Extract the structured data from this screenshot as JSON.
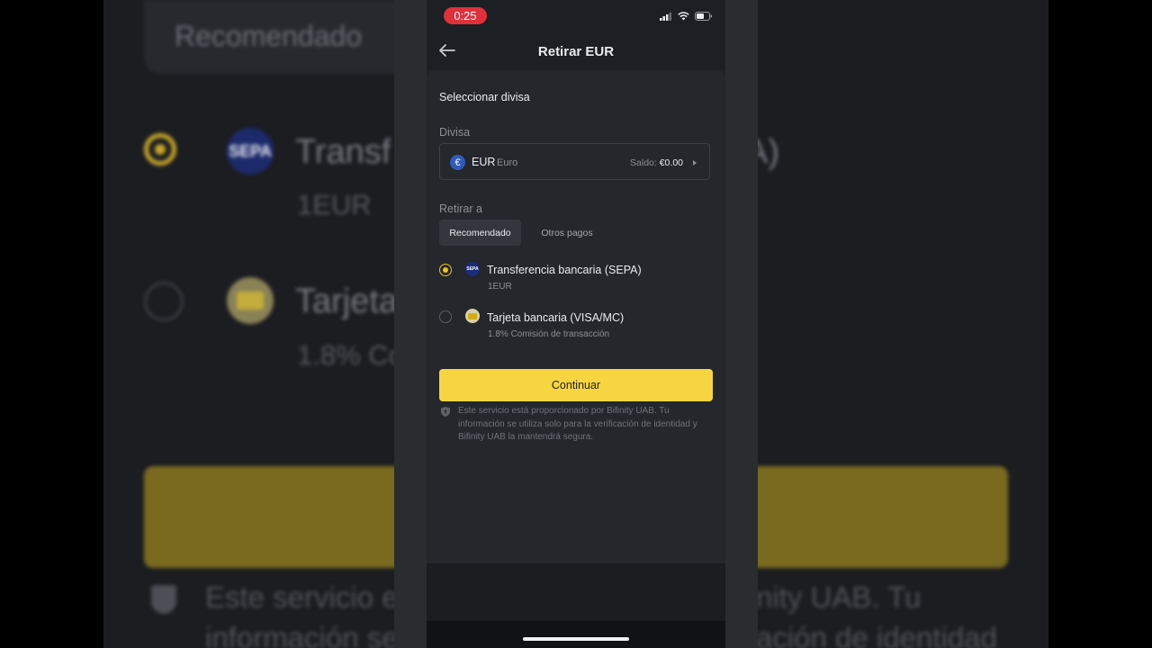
{
  "background": {
    "tab_recomendado": "Recomendado",
    "sepa_badge": "SEPA",
    "method1_title": "Transf",
    "method1_title_right": "A)",
    "method1_fee": "1EUR",
    "method2_title": "Tarjeta",
    "method2_fee": "1.8% Co",
    "disclaimer_left_1": "Este servicio e",
    "disclaimer_right_1": "nity UAB. Tu",
    "disclaimer_left_2": "información se",
    "disclaimer_right_2": "ación de identidad"
  },
  "status_bar": {
    "time": "0:25",
    "icons": [
      "signal-icon",
      "wifi-icon",
      "battery-icon"
    ]
  },
  "header": {
    "back_icon": "arrow-left-icon",
    "title": "Retirar EUR"
  },
  "currency_section": {
    "title": "Seleccionar divisa",
    "label": "Divisa",
    "currency_symbol": "€",
    "currency_code": "EUR",
    "currency_name": "Euro",
    "balance_label": "Saldo:",
    "balance_value": "€0.00"
  },
  "withdraw_section": {
    "label": "Retirar a",
    "tabs": [
      {
        "label": "Recomendado",
        "active": true
      },
      {
        "label": "Otros pagos",
        "active": false
      }
    ],
    "methods": [
      {
        "icon": "sepa-icon",
        "icon_text": "SEPA",
        "title": "Transferencia bancaria (SEPA)",
        "fee": "1EUR",
        "selected": true
      },
      {
        "icon": "bank-card-icon",
        "title": "Tarjeta bancaria (VISA/MC)",
        "fee": "1.8% Comisión de transacción",
        "selected": false
      }
    ]
  },
  "actions": {
    "continue_label": "Continuar"
  },
  "disclaimer": {
    "icon": "shield-icon",
    "text": "Este servicio está proporcionado por Bifinity UAB. Tu información se utiliza solo para la verificación de identidad y Bifinity UAB la mantendrá segura."
  },
  "colors": {
    "accent": "#f6d540",
    "radio_selected": "#f0c419",
    "time_pill": "#e0303b",
    "background": "#24272c"
  }
}
